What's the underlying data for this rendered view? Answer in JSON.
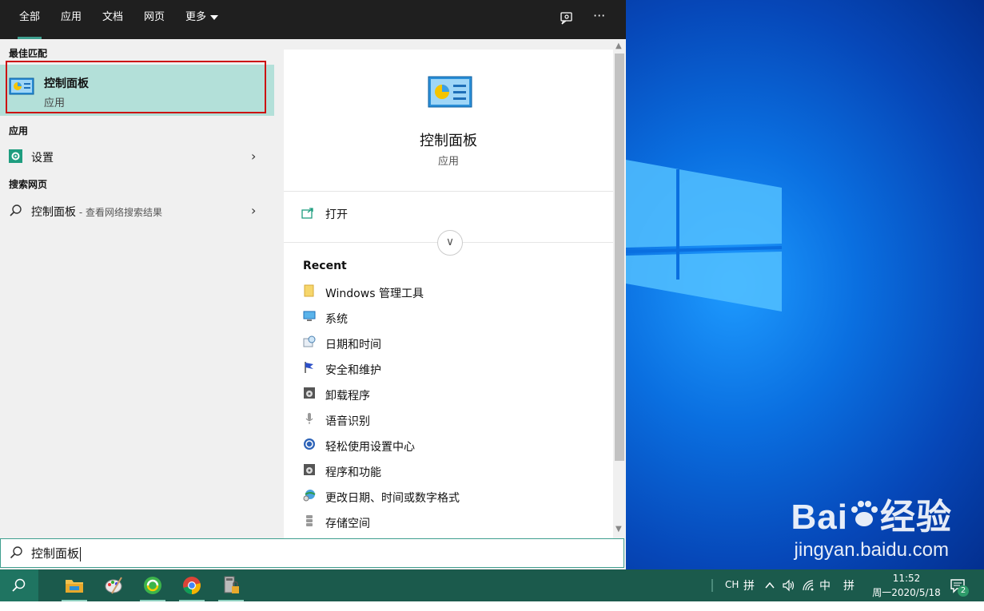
{
  "tabs": [
    {
      "label": "全部"
    },
    {
      "label": "应用"
    },
    {
      "label": "文档"
    },
    {
      "label": "网页"
    },
    {
      "label": "更多"
    }
  ],
  "topbar_icons": {
    "feedback": "feedback-icon",
    "more": "···"
  },
  "left": {
    "best_match_heading": "最佳匹配",
    "best_match": {
      "title": "控制面板",
      "subtitle": "应用",
      "icon": "control-panel-icon"
    },
    "apps_heading": "应用",
    "apps": [
      {
        "label": "设置",
        "icon": "settings-gear-icon"
      }
    ],
    "web_heading": "搜索网页",
    "web": [
      {
        "label": "控制面板",
        "suffix": " - 查看网络搜索结果",
        "icon": "search-icon"
      }
    ]
  },
  "detail": {
    "title": "控制面板",
    "subtitle": "应用",
    "open_label": "打开",
    "recent_heading": "Recent",
    "recent": [
      {
        "label": "Windows 管理工具",
        "icon": "folder-icon"
      },
      {
        "label": "系统",
        "icon": "monitor-icon"
      },
      {
        "label": "日期和时间",
        "icon": "calendar-clock-icon"
      },
      {
        "label": "安全和维护",
        "icon": "flag-icon"
      },
      {
        "label": "卸载程序",
        "icon": "programs-icon"
      },
      {
        "label": "语音识别",
        "icon": "microphone-icon"
      },
      {
        "label": "轻松使用设置中心",
        "icon": "ease-of-access-icon"
      },
      {
        "label": "程序和功能",
        "icon": "programs-icon"
      },
      {
        "label": "更改日期、时间或数字格式",
        "icon": "globe-clock-icon"
      },
      {
        "label": "存储空间",
        "icon": "storage-icon"
      }
    ]
  },
  "search": {
    "value": "控制面板"
  },
  "taskbar": {
    "apps": [
      "file-explorer-icon",
      "paint-icon",
      "browser-360-icon",
      "chrome-icon",
      "security-app-icon"
    ],
    "tray": {
      "ime_lang": "CH",
      "ime_mode": "中",
      "ime_grid": "拼"
    },
    "clock_time": "11:52",
    "clock_date": "周一2020/5/18",
    "notification_count": "2"
  },
  "watermark": {
    "brand_left": "Bai",
    "brand_right": "经验",
    "url": "jingyan.baidu.com"
  },
  "colors": {
    "accent": "#3f9f8f",
    "selection": "#b3e0d9",
    "outline": "#cc1111",
    "taskbar": "#1b5a4c",
    "topbar": "#1f1f1f"
  }
}
